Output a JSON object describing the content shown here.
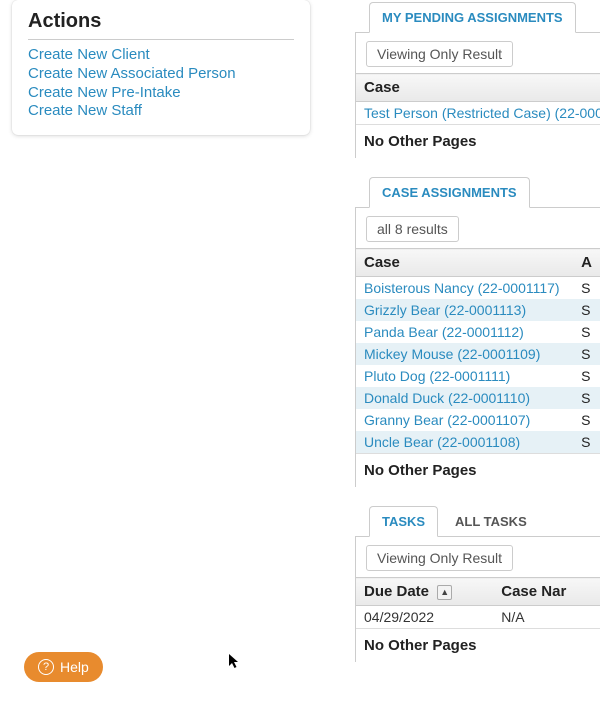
{
  "actions": {
    "title": "Actions",
    "links": [
      "Create New Client",
      "Create New Associated Person",
      "Create New Pre-Intake",
      "Create New Staff"
    ]
  },
  "pending": {
    "tab_label": "MY PENDING ASSIGNMENTS",
    "result_button": "Viewing Only Result",
    "col_case": "Case",
    "rows": [
      "Test Person (Restricted Case) (22-000"
    ],
    "footer": "No Other Pages"
  },
  "case_assignments": {
    "tab_label": "CASE ASSIGNMENTS",
    "result_button": "all 8 results",
    "col_case": "Case",
    "col_b": "A",
    "second_letter": "S",
    "rows": [
      "Boisterous Nancy (22-0001117)",
      "Grizzly Bear (22-0001113)",
      "Panda Bear (22-0001112)",
      "Mickey Mouse (22-0001109)",
      "Pluto Dog (22-0001111)",
      "Donald Duck (22-0001110)",
      "Granny Bear (22-0001107)",
      "Uncle Bear (22-0001108)"
    ],
    "footer": "No Other Pages"
  },
  "tasks": {
    "tab_active": "TASKS",
    "tab_inactive": "ALL TASKS",
    "result_button": "Viewing Only Result",
    "col_due": "Due Date",
    "col_case": "Case Nar",
    "rows": [
      {
        "due": "04/29/2022",
        "case": "N/A"
      }
    ],
    "footer": "No Other Pages"
  },
  "help_label": "Help"
}
